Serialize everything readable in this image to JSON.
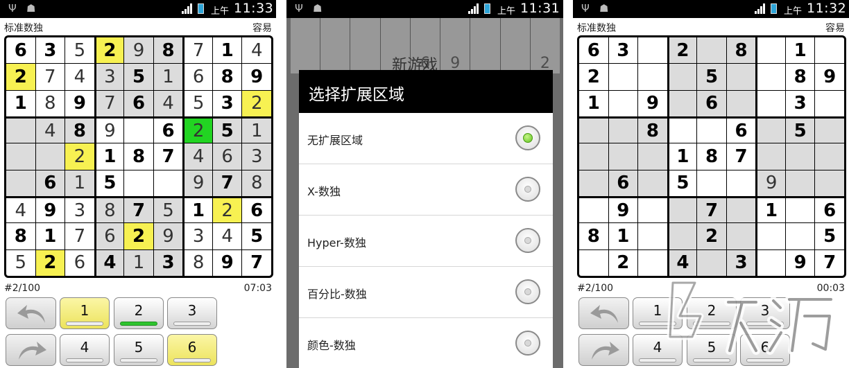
{
  "phones": [
    {
      "status": {
        "ampm": "上午",
        "time": "11:33"
      },
      "title": "标准数独",
      "difficulty": "容易",
      "puzzle_no": "#2/100",
      "timer": "07:03",
      "keys": [
        "1",
        "2",
        "3",
        "4",
        "5",
        "6"
      ],
      "keys_active": [
        0,
        5
      ],
      "keys_complete": [
        1
      ],
      "givens": [
        "63.2.8.1.",
        "2...5..89",
        "1.9.6..3.",
        "..8..6.5.",
        "...187...",
        ".6.5...9.",
        ".9..7.1.6",
        "81..2...5",
        ".2.4.3.97"
      ],
      "grid": [
        [
          "6",
          "3",
          "5",
          "2",
          "9",
          "8",
          "7",
          "1",
          "4"
        ],
        [
          "2",
          "7",
          "4",
          "3",
          "5",
          "1",
          "6",
          "8",
          "9"
        ],
        [
          "1",
          "8",
          "9",
          "7",
          "6",
          "4",
          "5",
          "3",
          "2"
        ],
        [
          "",
          "4",
          "8",
          "9",
          "",
          "6",
          "2",
          "5",
          "1"
        ],
        [
          "",
          "",
          "2",
          "1",
          "8",
          "7",
          "4",
          "6",
          "3"
        ],
        [
          "",
          "6",
          "1",
          "5",
          "",
          "",
          "9",
          "7",
          "8"
        ],
        [
          "4",
          "9",
          "3",
          "8",
          "7",
          "5",
          "1",
          "2",
          "6"
        ],
        [
          "8",
          "1",
          "7",
          "6",
          "2",
          "9",
          "3",
          "4",
          "5"
        ],
        [
          "5",
          "2",
          "6",
          "4",
          "1",
          "3",
          "8",
          "9",
          "7"
        ]
      ],
      "highlight_yellow": [
        [
          0,
          3
        ],
        [
          1,
          0
        ],
        [
          2,
          8
        ],
        [
          4,
          2
        ],
        [
          6,
          7
        ],
        [
          7,
          4
        ],
        [
          8,
          1
        ]
      ],
      "highlight_green": [
        [
          3,
          6
        ]
      ]
    },
    {
      "status": {
        "ampm": "上午",
        "time": "11:31"
      },
      "background_title": "新游戏",
      "background_digits": [
        "",
        "",
        "",
        "",
        "6",
        "9",
        "",
        "",
        "2"
      ],
      "dialog": {
        "title": "选择扩展区域",
        "options": [
          {
            "label": "无扩展区域",
            "selected": true
          },
          {
            "label": "X-数独",
            "selected": false
          },
          {
            "label": "Hyper-数独",
            "selected": false
          },
          {
            "label": "百分比-数独",
            "selected": false
          },
          {
            "label": "颜色-数独",
            "selected": false
          }
        ]
      }
    },
    {
      "status": {
        "ampm": "上午",
        "time": "11:32"
      },
      "title": "标准数独",
      "difficulty": "容易",
      "puzzle_no": "#2/100",
      "timer": "00:03",
      "keys": [
        "1",
        "2",
        "3",
        "4",
        "5",
        "6"
      ],
      "keys_active": [],
      "keys_complete": [],
      "givens": [
        "63.2.8.1.",
        "2...5..89",
        "1.9.6..3.",
        "..8..6.5.",
        "...187...",
        ".6.5...9.",
        ".9..7.1.6",
        "81..2...5",
        ".2.4.3.97"
      ],
      "grid": [
        [
          "6",
          "3",
          "",
          "2",
          "",
          "8",
          "",
          "1",
          ""
        ],
        [
          "2",
          "",
          "",
          "",
          "5",
          "",
          "",
          "8",
          "9"
        ],
        [
          "1",
          "",
          "9",
          "",
          "6",
          "",
          "",
          "3",
          ""
        ],
        [
          "",
          "",
          "8",
          "",
          "",
          "6",
          "",
          "5",
          ""
        ],
        [
          "",
          "",
          "",
          "1",
          "8",
          "7",
          "",
          "",
          ""
        ],
        [
          "",
          "6",
          "",
          "5",
          "",
          "",
          "9",
          "",
          ""
        ],
        [
          "",
          "9",
          "",
          "",
          "7",
          "",
          "1",
          "",
          "6"
        ],
        [
          "8",
          "1",
          "",
          "",
          "2",
          "",
          "",
          "",
          "5"
        ],
        [
          "",
          "2",
          "",
          "4",
          "",
          "3",
          "",
          "9",
          "7"
        ]
      ],
      "highlight_yellow": [],
      "highlight_green": []
    }
  ],
  "colors": {
    "highlight_yellow": "#f7f152",
    "highlight_green": "#22d422",
    "shade": "#dcdcdc",
    "dialog_header": "#000000",
    "radio_selected": "#5fc41c"
  }
}
